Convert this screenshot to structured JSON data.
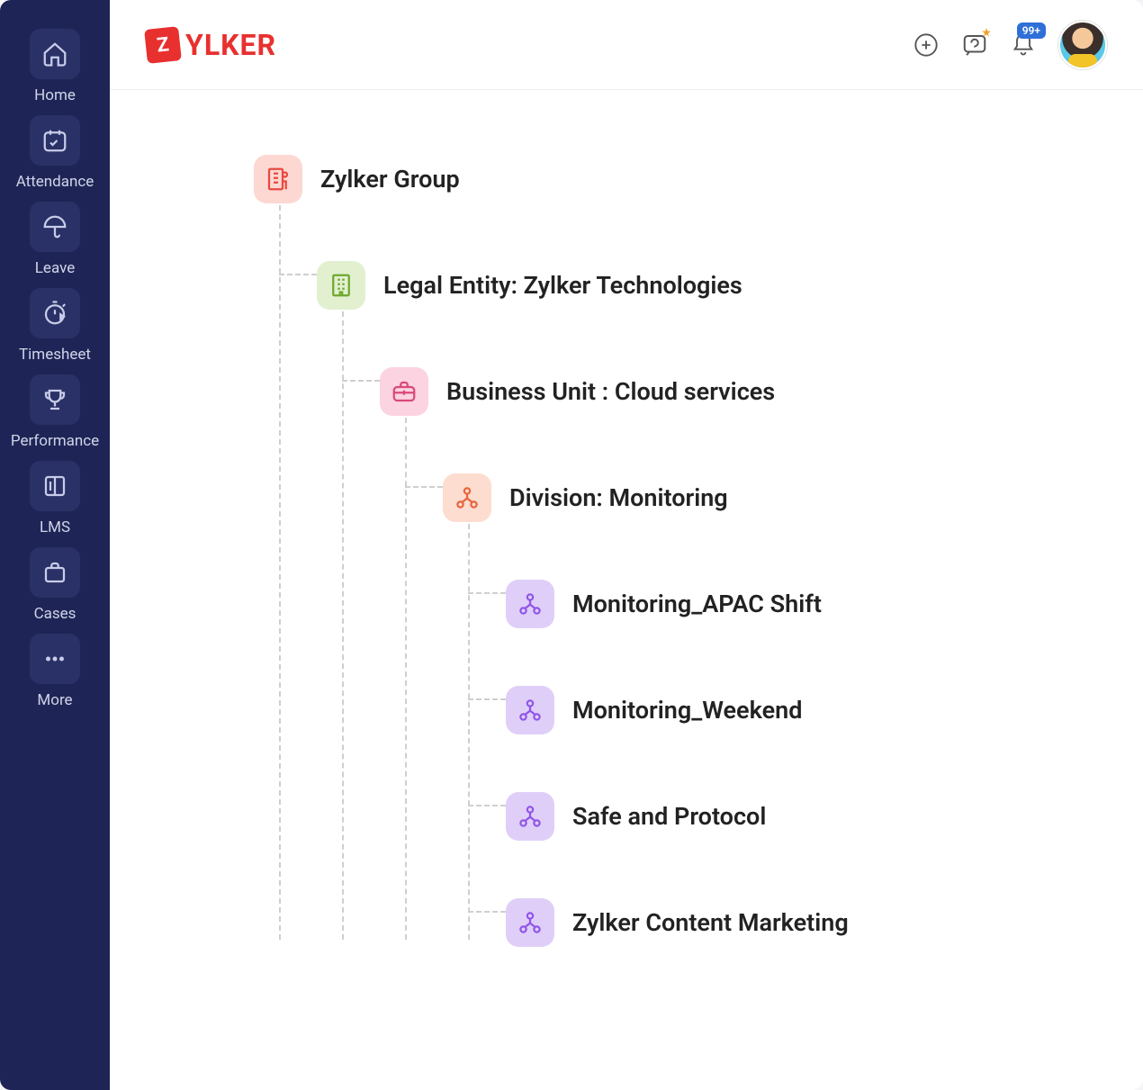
{
  "brand": {
    "badge": "Z",
    "text": "YLKER"
  },
  "topbar": {
    "notification_badge": "99+"
  },
  "sidebar": {
    "items": [
      {
        "label": "Home"
      },
      {
        "label": "Attendance"
      },
      {
        "label": "Leave"
      },
      {
        "label": "Timesheet"
      },
      {
        "label": "Performance"
      },
      {
        "label": "LMS"
      },
      {
        "label": "Cases"
      },
      {
        "label": "More"
      }
    ]
  },
  "tree": {
    "root": {
      "label": "Zylker Group"
    },
    "entity": {
      "label": "Legal Entity: Zylker Technologies"
    },
    "unit": {
      "label": "Business Unit : Cloud services"
    },
    "division": {
      "label": "Division: Monitoring"
    },
    "leaves": [
      {
        "label": "Monitoring_APAC Shift"
      },
      {
        "label": "Monitoring_Weekend"
      },
      {
        "label": "Safe and Protocol"
      },
      {
        "label": "Zylker Content Marketing"
      }
    ]
  }
}
